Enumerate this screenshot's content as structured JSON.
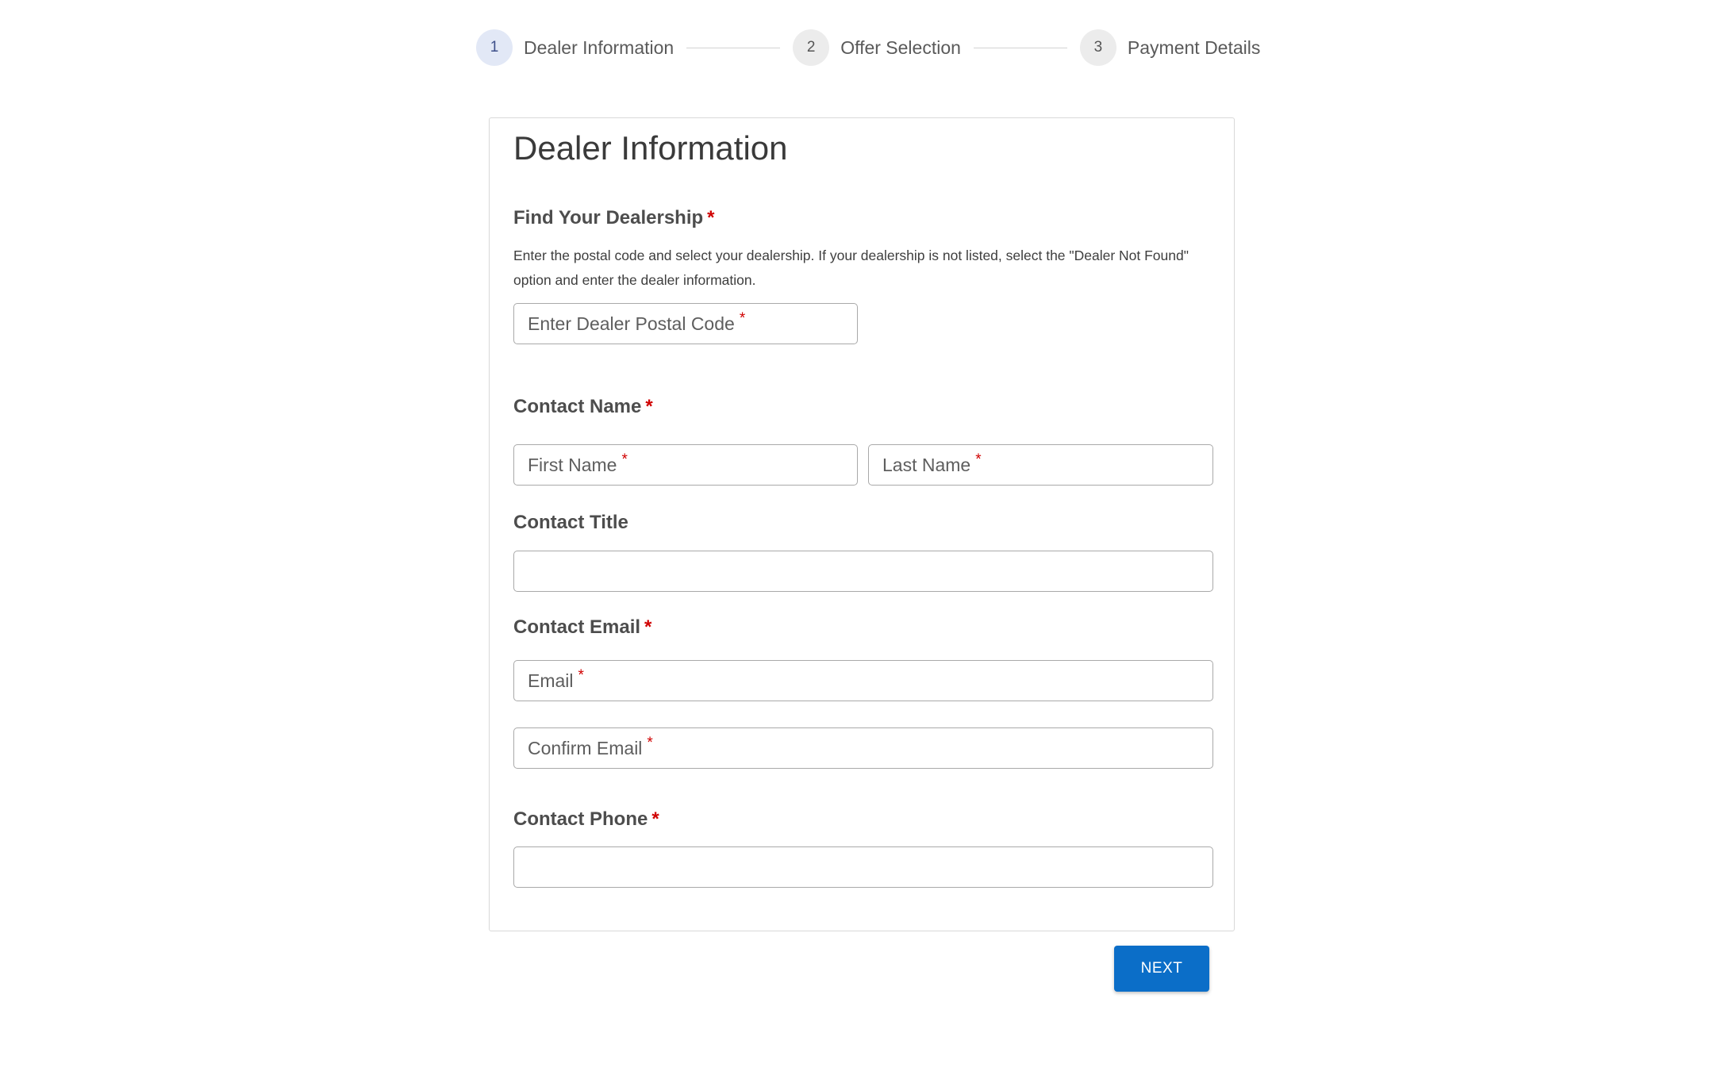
{
  "stepper": {
    "steps": [
      {
        "number": "1",
        "label": "Dealer Information"
      },
      {
        "number": "2",
        "label": "Offer Selection"
      },
      {
        "number": "3",
        "label": "Payment Details"
      }
    ]
  },
  "form": {
    "title": "Dealer Information",
    "required_marker": "*",
    "dealership": {
      "label": "Find Your Dealership",
      "help": "Enter the postal code and select your dealership. If your dealership is not listed, select the \"Dealer Not Found\" option and enter the dealer information.",
      "postal_placeholder": "Enter Dealer Postal Code"
    },
    "contact_name": {
      "label": "Contact Name",
      "first_placeholder": "First Name",
      "last_placeholder": "Last Name"
    },
    "contact_title": {
      "label": "Contact Title",
      "value": ""
    },
    "contact_email": {
      "label": "Contact Email",
      "email_placeholder": "Email",
      "confirm_placeholder": "Confirm Email"
    },
    "contact_phone": {
      "label": "Contact Phone",
      "value": ""
    }
  },
  "actions": {
    "next_label": "NEXT"
  },
  "colors": {
    "primary": "#0b6ec8",
    "required": "#d00000",
    "active_step_bg": "#e2e8f6"
  }
}
